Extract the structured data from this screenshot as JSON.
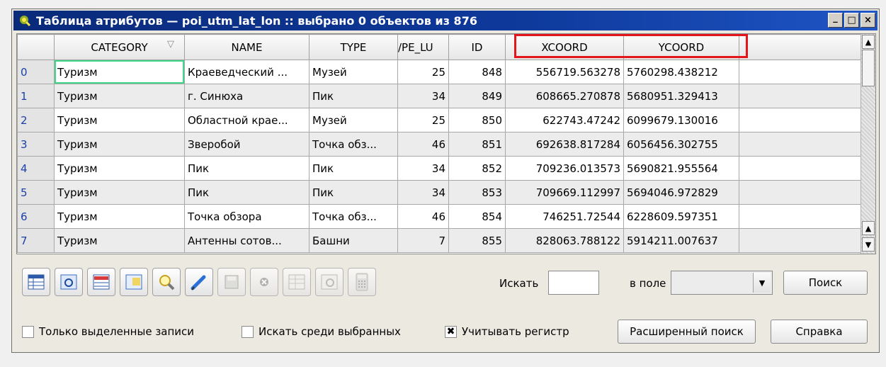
{
  "window": {
    "title": "Таблица атрибутов — poi_utm_lat_lon :: выбрано 0 объектов из 876",
    "controls": [
      "_",
      "□",
      "×"
    ]
  },
  "table": {
    "columns": [
      "",
      "CATEGORY",
      "NAME",
      "TYPE",
      "/PE_LU",
      "ID",
      "XCOORD",
      "YCOORD"
    ],
    "rows": [
      {
        "index": "0",
        "category": "Туризм",
        "name": "Краеведческий ...",
        "type": "Музей",
        "type_lu": "25",
        "id": "848",
        "xcoord": "556719.563278",
        "ycoord": "5760298.438212"
      },
      {
        "index": "1",
        "category": "Туризм",
        "name": "г. Синюха",
        "type": "Пик",
        "type_lu": "34",
        "id": "849",
        "xcoord": "608665.270878",
        "ycoord": "5680951.329413"
      },
      {
        "index": "2",
        "category": "Туризм",
        "name": "Областной крае...",
        "type": "Музей",
        "type_lu": "25",
        "id": "850",
        "xcoord": "622743.47242",
        "ycoord": "6099679.130016"
      },
      {
        "index": "3",
        "category": "Туризм",
        "name": "Зверобой",
        "type": "Точка обз...",
        "type_lu": "46",
        "id": "851",
        "xcoord": "692638.817284",
        "ycoord": "6056456.302755"
      },
      {
        "index": "4",
        "category": "Туризм",
        "name": "Пик",
        "type": "Пик",
        "type_lu": "34",
        "id": "852",
        "xcoord": "709236.013573",
        "ycoord": "5690821.955564"
      },
      {
        "index": "5",
        "category": "Туризм",
        "name": "Пик",
        "type": "Пик",
        "type_lu": "34",
        "id": "853",
        "xcoord": "709669.112997",
        "ycoord": "5694046.972829"
      },
      {
        "index": "6",
        "category": "Туризм",
        "name": "Точка обзора",
        "type": "Точка обз...",
        "type_lu": "46",
        "id": "854",
        "xcoord": "746251.72544",
        "ycoord": "6228609.597351"
      },
      {
        "index": "7",
        "category": "Туризм",
        "name": "Антенны сотов...",
        "type": "Башни",
        "type_lu": "7",
        "id": "855",
        "xcoord": "828063.788122",
        "ycoord": "5914211.007637"
      }
    ],
    "highlight_color": "#e5161b",
    "current_cell_color": "#3fd88a"
  },
  "toolbar": {
    "buttons": [
      {
        "icon": "table-icon",
        "enabled": true
      },
      {
        "icon": "zoom-to-selection-icon",
        "enabled": true
      },
      {
        "icon": "move-selection-to-top-icon",
        "enabled": true
      },
      {
        "icon": "invert-selection-icon",
        "enabled": true
      },
      {
        "icon": "magnifier-icon",
        "enabled": true
      },
      {
        "icon": "pencil-icon",
        "enabled": true
      },
      {
        "icon": "save-icon",
        "enabled": false
      },
      {
        "icon": "delete-icon",
        "enabled": false
      },
      {
        "icon": "new-column-icon",
        "enabled": false
      },
      {
        "icon": "delete-column-icon",
        "enabled": false
      },
      {
        "icon": "calculator-icon",
        "enabled": false
      }
    ],
    "search_label": "Искать",
    "search_value": "",
    "field_label": "в поле",
    "field_value": "",
    "search_button": "Поиск"
  },
  "footer": {
    "only_selected": {
      "label": "Только выделенные записи",
      "checked": false
    },
    "search_selected": {
      "label": "Искать среди выбранных",
      "checked": false
    },
    "case_sensitive": {
      "label": "Учитывать регистр",
      "checked": true
    },
    "advanced_search": "Расширенный поиск",
    "help": "Справка"
  }
}
